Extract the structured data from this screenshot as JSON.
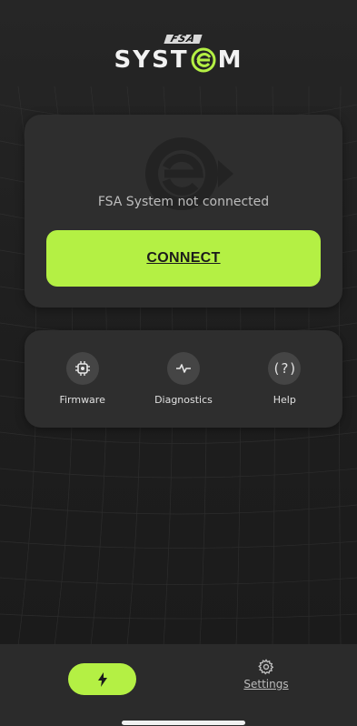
{
  "app": {
    "logo_top": "FSA",
    "logo_word_left": "SYST",
    "logo_word_right": "M"
  },
  "connect_card": {
    "status_text": "FSA System not connected",
    "connect_label": "CONNECT"
  },
  "tools": [
    {
      "label": "Firmware",
      "icon": "chip-icon"
    },
    {
      "label": "Diagnostics",
      "icon": "pulse-icon"
    },
    {
      "label": "Help",
      "icon": "help-icon",
      "glyph": "(?)"
    }
  ],
  "bottom_nav": {
    "active_icon": "lightning-icon",
    "settings_label": "Settings",
    "settings_icon": "gear-icon"
  },
  "colors": {
    "accent": "#b4f044",
    "background": "#1f1f1f",
    "card": "#2e2e2e"
  }
}
